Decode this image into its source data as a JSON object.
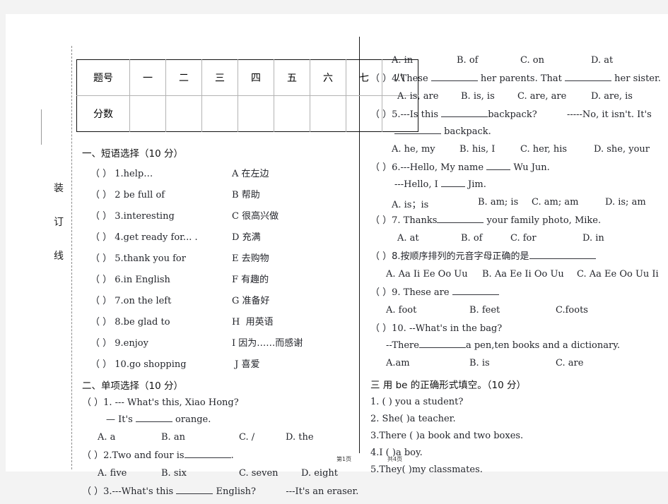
{
  "page": {
    "binding_marks": [
      "装",
      "订",
      "线"
    ],
    "footer_page": "第1页",
    "footer_total": "共4页"
  },
  "score_table": {
    "row_label_1": "题号",
    "row_label_2": "分数",
    "columns": [
      "一",
      "二",
      "三",
      "四",
      "五",
      "六",
      "七",
      "八"
    ]
  },
  "section_one": {
    "heading": "一、短语选择（10 分）",
    "items": [
      {
        "mark": "（      ）",
        "q": "1.help…",
        "opt": "A",
        "ans": "在左边"
      },
      {
        "mark": "（      ）",
        "q": "2 be full of",
        "opt": "B",
        "ans": "帮助"
      },
      {
        "mark": "（      ）",
        "q": "3.interesting",
        "opt": "C",
        "ans": "很高兴做"
      },
      {
        "mark": "（      ）",
        "q": "4.get ready for... .",
        "opt": "D",
        "ans": "充满"
      },
      {
        "mark": "（      ）",
        "q": "5.thank you for",
        "opt": "E",
        "ans": "去购物"
      },
      {
        "mark": "（      ）",
        "q": "6.in English",
        "opt": "F",
        "ans": "有趣的"
      },
      {
        "mark": "（      ）",
        "q": "7.on the left",
        "opt": "G",
        "ans": "准备好"
      },
      {
        "mark": "（      ）",
        "q": "8.be glad to",
        "opt": "H",
        "ans": "用英语"
      },
      {
        "mark": "（      ）",
        "q": "9.enjoy",
        "opt": "I",
        "ans": "因为……而感谢"
      },
      {
        "mark": "（      ）",
        "q": "10.go shopping",
        "opt": "J",
        "ans": "喜爱"
      }
    ]
  },
  "section_two": {
    "heading": "二、单项选择（10 分）",
    "q1_line1": "（      ）1. --- What's this, Xiao Hong?",
    "q1_line2_a": "— It's",
    "q1_line2_b": "orange.",
    "q1_opts": [
      "A. a",
      "B. an",
      "C. /",
      "D. the"
    ],
    "q2_line": "（      ）2.Two and four is",
    "q2_tail": ".",
    "q2_opts": [
      "A. five",
      "B. six",
      "C. seven",
      "D. eight"
    ],
    "q3_line_a": "（      ）3.---What's this",
    "q3_line_b": "English?",
    "q3_line_c": "---It's an eraser.",
    "q3_opts": [
      "A. in",
      "B. of",
      "C. on",
      "D. at"
    ],
    "q4_line_a": "（      ）4.These",
    "q4_line_b": "her parents. That",
    "q4_line_c": "her sister.",
    "q4_opts": [
      "A. is, are",
      "B. is, is",
      "C. are, are",
      "D. are, is"
    ],
    "q5_line_a": "（      ）5.---Is this",
    "q5_line_b": "backpack?",
    "q5_line_c": "-----No, it isn't. It's",
    "q5_line2": "backpack.",
    "q5_opts": [
      "A. he, my",
      "B. his, I",
      "C. her, his",
      "D. she, your"
    ],
    "q6_line_a": "（      ）6.---Hello, My name",
    "q6_line_b": "Wu Jun.",
    "q6_line2_a": "---Hello, I",
    "q6_line2_b": "Jim.",
    "q6_opts": [
      "A. is；is",
      "B. am; is",
      "C. am; am",
      "D. is; am"
    ],
    "q7_line_a": "（      ）7. Thanks",
    "q7_line_b": "your family photo, Mike.",
    "q7_opts": [
      "A. at",
      "B. of",
      "C. for",
      "D. in"
    ],
    "q8_line": "（      ）8.按顺序排列的元音字母正确的是",
    "q8_opts": [
      "A. Aa Ii Ee Oo Uu",
      "B. Aa Ee Ii Oo Uu",
      "C. Aa Ee Oo Uu Ii"
    ],
    "q9_line": "（      ）9. These are",
    "q9_opts": [
      "A. foot",
      "B. feet",
      "C.foots"
    ],
    "q10_line": "（      ）10. --What's in the bag?",
    "q10_line2_a": "--There",
    "q10_line2_b": "a pen,ten books and a dictionary.",
    "q10_opts": [
      "A.am",
      "B. is",
      "C. are"
    ]
  },
  "section_three": {
    "heading": "三 用 be 的正确形式填空。（10 分）",
    "items": [
      "1. (           ) you a student?",
      "2. She(           )a teacher.",
      "3.There (           )a book and two boxes.",
      "4.I (      )a  boy.",
      "5.They(      )my classmates."
    ]
  }
}
